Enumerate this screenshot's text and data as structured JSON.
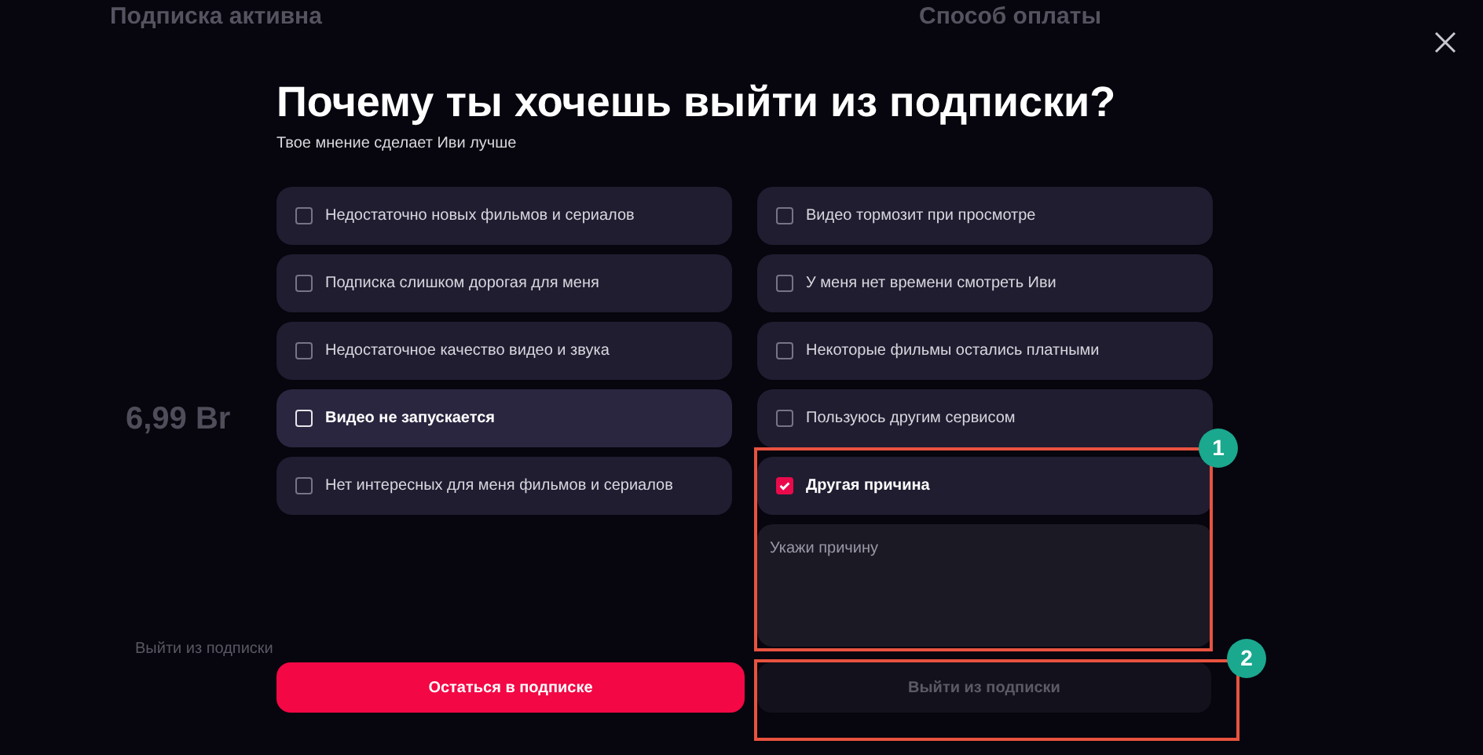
{
  "background_page": {
    "texts": [
      "Подписка активна",
      "Способ оплаты",
      "6,99 Br",
      "Выйти из подписки"
    ]
  },
  "dialog": {
    "title": "Почему ты хочешь выйти из подписки?",
    "subtitle": "Твое мнение сделает Иви лучше",
    "reasons": [
      {
        "label": "Недостаточно новых фильмов и сериалов",
        "checked": false,
        "hovered": false
      },
      {
        "label": "Подписка слишком дорогая для меня",
        "checked": false,
        "hovered": false
      },
      {
        "label": "Недостаточное качество видео и звука",
        "checked": false,
        "hovered": false
      },
      {
        "label": "Видео не запускается",
        "checked": false,
        "hovered": true
      },
      {
        "label": "Нет интересных для меня фильмов и сериалов",
        "checked": false,
        "hovered": false
      },
      {
        "label": "Видео тормозит при просмотре",
        "checked": false,
        "hovered": false
      },
      {
        "label": "У меня нет времени смотреть Иви",
        "checked": false,
        "hovered": false
      },
      {
        "label": "Некоторые фильмы остались платными",
        "checked": false,
        "hovered": false
      },
      {
        "label": "Пользуюсь другим сервисом",
        "checked": false,
        "hovered": false
      },
      {
        "label": "Другая причина",
        "checked": true,
        "hovered": false
      }
    ],
    "comment": {
      "placeholder": "Укажи причину"
    },
    "buttons": [
      {
        "label": "Остаться в подписке",
        "kind": "primary",
        "disabled": false
      },
      {
        "label": "Выйти из подписки",
        "kind": "secondary",
        "disabled": true
      }
    ]
  },
  "annotations": [
    {
      "number": "1"
    },
    {
      "number": "2"
    }
  ]
}
